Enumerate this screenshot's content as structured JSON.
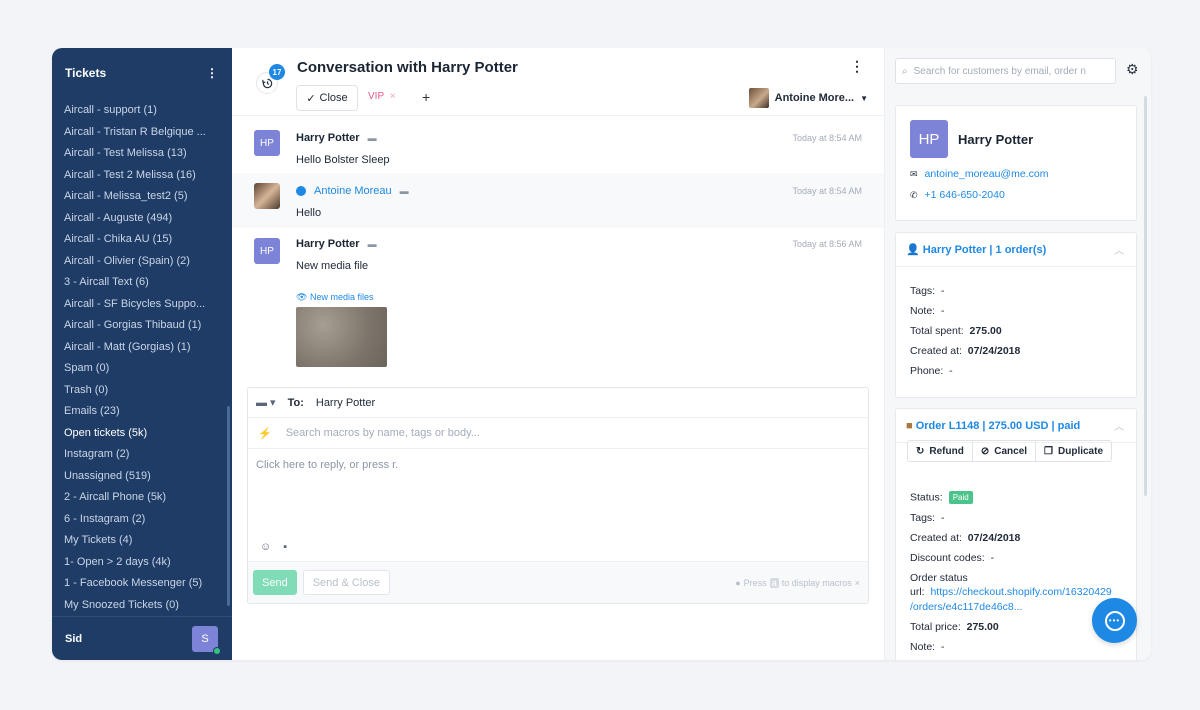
{
  "sidebar": {
    "title": "Tickets",
    "items": [
      {
        "label": "Aircall - support (1)"
      },
      {
        "label": "Aircall - Tristan R Belgique ..."
      },
      {
        "label": "Aircall - Test Melissa (13)"
      },
      {
        "label": "Aircall - Test 2 Melissa (16)"
      },
      {
        "label": "Aircall - Melissa_test2 (5)"
      },
      {
        "label": "Aircall - Auguste (494)"
      },
      {
        "label": "Aircall - Chika AU (15)"
      },
      {
        "label": "Aircall - Olivier (Spain) (2)"
      },
      {
        "label": "3 - Aircall Text (6)"
      },
      {
        "label": "Aircall - SF Bicycles Suppo..."
      },
      {
        "label": "Aircall - Gorgias Thibaud (1)"
      },
      {
        "label": "Aircall - Matt (Gorgias) (1)"
      },
      {
        "label": "Spam (0)"
      },
      {
        "label": "Trash (0)"
      },
      {
        "label": "Emails (23)"
      },
      {
        "label": "Open tickets (5k)"
      },
      {
        "label": "Instagram (2)"
      },
      {
        "label": "Unassigned (519)"
      },
      {
        "label": "2 - Aircall Phone (5k)"
      },
      {
        "label": "6 - Instagram (2)"
      },
      {
        "label": "My Tickets (4)"
      },
      {
        "label": "1- Open > 2 days (4k)"
      },
      {
        "label": "1 - Facebook Messenger (5)"
      },
      {
        "label": "My Snoozed Tickets (0)"
      }
    ],
    "active_index": 15,
    "user": {
      "name": "Sid",
      "initial": "S"
    }
  },
  "header": {
    "badge_count": "17",
    "title": "Conversation with Harry Potter",
    "close_label": "Close",
    "tag_label": "VIP",
    "agent_name": "Antoine More..."
  },
  "messages": [
    {
      "initials": "HP",
      "author": "Harry Potter",
      "time": "Today at 8:54 AM",
      "text": "Hello Bolster Sleep"
    },
    {
      "initials": "",
      "author": "Antoine Moreau",
      "time": "Today at 8:54 AM",
      "text": "Hello"
    },
    {
      "initials": "HP",
      "author": "Harry Potter",
      "time": "Today at 8:56 AM",
      "text": "New media file",
      "media_label": "New media files"
    }
  ],
  "reply": {
    "to_label": "To:",
    "to_value": "Harry Potter",
    "macros_placeholder": "Search macros by name, tags or body...",
    "body_placeholder": "Click here to reply, or press r.",
    "send_label": "Send",
    "send_close_label": "Send & Close",
    "hint_prefix": "Press",
    "hint_key": "a",
    "hint_suffix": "to display macros"
  },
  "customer": {
    "search_placeholder": "Search for customers by email, order n",
    "initials": "HP",
    "name": "Harry Potter",
    "email": "antoine_moreau@me.com",
    "phone": "+1 646-650-2040"
  },
  "shopify_customer": {
    "heading": "Harry Potter | 1 order(s)",
    "fields": [
      {
        "label": "Tags:",
        "value": "-"
      },
      {
        "label": "Note:",
        "value": "-"
      },
      {
        "label": "Total spent:",
        "value": "275.00"
      },
      {
        "label": "Created at:",
        "value": "07/24/2018"
      },
      {
        "label": "Phone:",
        "value": "-"
      }
    ]
  },
  "order": {
    "heading": "Order L1148 | 275.00 USD | paid",
    "refund_label": "Refund",
    "cancel_label": "Cancel",
    "duplicate_label": "Duplicate",
    "status_label": "Status:",
    "status_value": "Paid",
    "tags_label": "Tags:",
    "tags_value": "-",
    "created_label": "Created at:",
    "created_value": "07/24/2018",
    "discount_label": "Discount codes:",
    "discount_value": "-",
    "order_status_label": "Order status",
    "url_label": "url:",
    "url_line1": "https://checkout.shopify.com/16320429",
    "url_line2": "/orders/e4c117de46c8...",
    "total_label": "Total price:",
    "total_value": "275.00",
    "note_label": "Note:",
    "note_value": "-"
  },
  "colors": {
    "sidebar_bg": "#1f3c66",
    "accent": "#1e88e5",
    "avatar": "#7d84d8",
    "send": "#7fdcb6",
    "paid": "#4cc38a"
  }
}
